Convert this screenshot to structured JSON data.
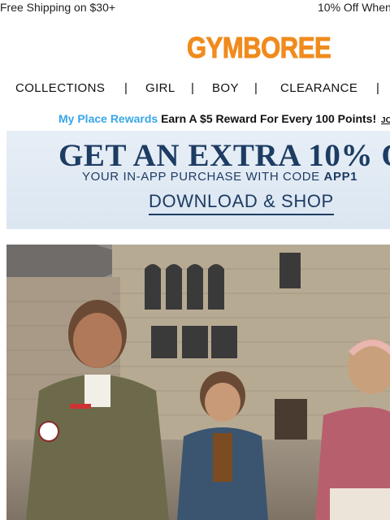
{
  "promo": {
    "left_text": "Free Shipping on $30+",
    "right_text": "10% Off When"
  },
  "brand": {
    "logo_text": "GYMBOREE",
    "logo_color": "#f08b1d"
  },
  "nav": {
    "items": [
      {
        "label": "COLLECTIONS"
      },
      {
        "label": "GIRL"
      },
      {
        "label": "BOY"
      },
      {
        "label": "CLEARANCE"
      }
    ],
    "separator": "|"
  },
  "rewards": {
    "brand": "My Place Rewards",
    "message": "Earn A $5 Reward For Every 100 Points!",
    "join": "JO"
  },
  "banner": {
    "headline": "GET AN EXTRA 10% O",
    "sub_prefix": "YOUR IN-APP PURCHASE WITH CODE ",
    "code": "APP1",
    "cta": "DOWNLOAD & SHOP",
    "text_color": "#1d3c63"
  },
  "hero": {
    "alt_description_icon": "hero-photo"
  }
}
